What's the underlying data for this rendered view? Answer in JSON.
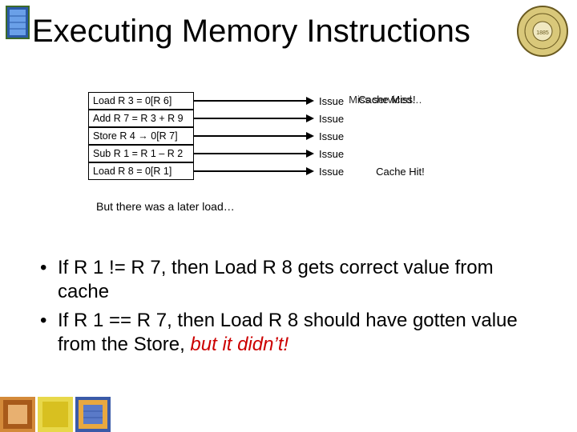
{
  "title": "Executing Memory Instructions",
  "instructions": [
    {
      "text": "Load R 3 = 0[R 6]",
      "issue": "Issue"
    },
    {
      "text": "Add R 7 = R 3 + R 9",
      "issue": "Issue"
    },
    {
      "text": "Store R 4 → 0[R 7]",
      "issue": "Issue"
    },
    {
      "text": "Sub R 1 = R 1 – R 2",
      "issue": "Issue"
    },
    {
      "text": "Load R 8 = 0[R 1]",
      "issue": "Issue"
    }
  ],
  "row0_annot_a": "Cache Miss!",
  "row0_annot_b": "Miss serviced…",
  "row4_annot": "Cache Hit!",
  "later_load_note": "But there was a later load…",
  "bullet1_a": "If R 1 != R 7, then Load R 8 gets correct value from cache",
  "bullet2_a": "If R 1 == R 7, then Load R 8 should have gotten value from the Store, ",
  "bullet2_b": "but it didn’t!",
  "icons": {
    "seal": "institute-seal-icon",
    "chip": "chip-die-icon",
    "thumb1": "chip-thumb-1",
    "thumb2": "chip-thumb-2",
    "thumb3": "chip-thumb-3"
  }
}
